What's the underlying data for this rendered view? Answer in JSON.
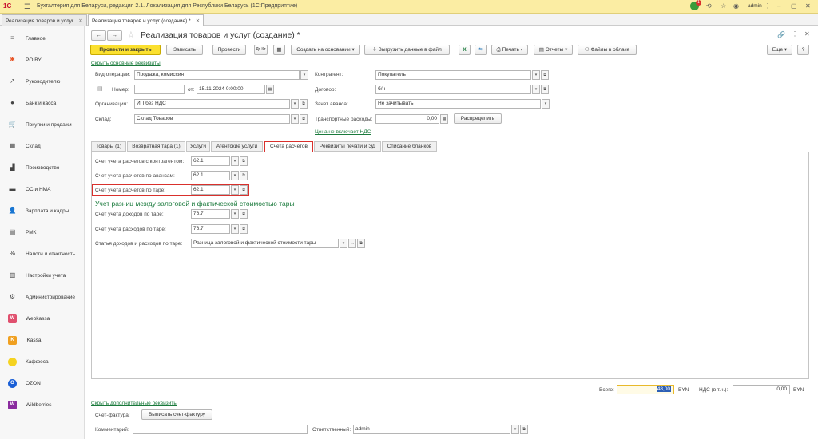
{
  "app": {
    "logo": "1С",
    "title": "Бухгалтерия для Беларуси, редакция 2.1. Локализация для Республики Беларусь  (1С:Предприятие)",
    "user": "admin",
    "notification_count": "1"
  },
  "window_tabs": [
    {
      "label": "Реализация товаров и услуг"
    },
    {
      "label": "Реализация товаров и услуг (создание) *"
    }
  ],
  "sidebar": {
    "items": [
      {
        "label": "Главное",
        "icon": "menu-icon",
        "glyph": "≡"
      },
      {
        "label": "PO.BY",
        "icon": "asterisk-icon",
        "glyph": "✱"
      },
      {
        "label": "Руководителю",
        "icon": "trend-icon",
        "glyph": "↗"
      },
      {
        "label": "Банк и касса",
        "icon": "coin-icon",
        "glyph": "●"
      },
      {
        "label": "Покупки и продажи",
        "icon": "cart-icon",
        "glyph": "🛒"
      },
      {
        "label": "Склад",
        "icon": "warehouse-icon",
        "glyph": "▦"
      },
      {
        "label": "Производство",
        "icon": "factory-icon",
        "glyph": "▟"
      },
      {
        "label": "ОС и НМА",
        "icon": "truck-icon",
        "glyph": "▬"
      },
      {
        "label": "Зарплата и кадры",
        "icon": "person-icon",
        "glyph": "👤"
      },
      {
        "label": "РМК",
        "icon": "register-icon",
        "glyph": "▤"
      },
      {
        "label": "Налоги и отчетность",
        "icon": "tax-icon",
        "glyph": "%"
      },
      {
        "label": "Настройки учета",
        "icon": "book-icon",
        "glyph": "▥"
      },
      {
        "label": "Администрирование",
        "icon": "gear-icon",
        "glyph": "⚙"
      },
      {
        "label": "Webkassa",
        "icon": "webkassa-icon",
        "glyph": "W"
      },
      {
        "label": "iKassa",
        "icon": "ikassa-icon",
        "glyph": "K"
      },
      {
        "label": "Каффеса",
        "icon": "kaffesa-icon",
        "glyph": ""
      },
      {
        "label": "OZON",
        "icon": "ozon-icon",
        "glyph": "O"
      },
      {
        "label": "Wildberries",
        "icon": "wildberries-icon",
        "glyph": "W"
      }
    ]
  },
  "form": {
    "title": "Реализация товаров и услуг (создание) *",
    "toolbar": {
      "post_close": "Провести и закрыть",
      "save": "Записать",
      "post": "Провести",
      "create_based": "Создать на основании",
      "export": "Выгрузить данные в файл",
      "print": "Печать",
      "reports": "Отчеты",
      "cloud": "Файлы в облаке",
      "more": "Еще",
      "help": "?"
    },
    "hide_main_link": "Скрыть основные реквизиты",
    "operation_label": "Вид операции:",
    "operation_value": "Продажа, комиссия",
    "number_label": "Номер:",
    "number_value": "",
    "date_label": "от:",
    "date_value": "15.11.2024  0:00:00",
    "org_label": "Организация:",
    "org_value": "ИП без НДС",
    "warehouse_label": "Склад:",
    "warehouse_value": "Склад Товаров",
    "contractor_label": "Контрагент:",
    "contractor_value": "Покупатель",
    "contract_label": "Договор:",
    "contract_value": "б/н",
    "advance_label": "Зачет аванса:",
    "advance_value": "Не зачитывать",
    "transport_label": "Транспортные расходы:",
    "transport_value": "0,00",
    "distribute": "Распределить",
    "vat_link": "Цена не включает НДС",
    "tabs": [
      {
        "label": "Товары (1)"
      },
      {
        "label": "Возвратная тара (1)"
      },
      {
        "label": "Услуги"
      },
      {
        "label": "Агентские услуги"
      },
      {
        "label": "Счета расчетов"
      },
      {
        "label": "Реквизиты печати и ЭД"
      },
      {
        "label": "Списание бланков"
      }
    ],
    "accounts": {
      "contractor_label": "Счет учета расчетов с контрагентом:",
      "contractor_value": "62.1",
      "advance_label": "Счет учета расчетов по авансам:",
      "advance_value": "62.1",
      "tare_label": "Счет учета расчетов по таре:",
      "tare_value": "62.1",
      "section_title": "Учет разниц между залоговой и фактической стоимостью тары",
      "income_label": "Счет учета доходов по таре:",
      "income_value": "76.7",
      "expense_label": "Счет учета расходов по таре:",
      "expense_value": "76.7",
      "article_label": "Статья доходов и расходов по таре:",
      "article_value": "Разница залоговой и фактической стоимости тары"
    },
    "total_label": "Всего:",
    "total_value": "48,00",
    "currency": "BYN",
    "vat_label": "НДС (в т.ч.):",
    "vat_value": "0,00",
    "vat_currency": "BYN",
    "show_extra_link": "Скрыть дополнительные реквизиты",
    "invoice_label": "Счет-фактура:",
    "invoice_button": "Выписать счет-фактуру",
    "comment_label": "Комментарий:",
    "comment_value": "",
    "responsible_label": "Ответственный:",
    "responsible_value": "admin"
  },
  "colors": {
    "accent_yellow": "#fbe02f",
    "titlebar": "#fbeda3",
    "link_green": "#1a7a3c",
    "highlight_red": "#d9302c"
  }
}
